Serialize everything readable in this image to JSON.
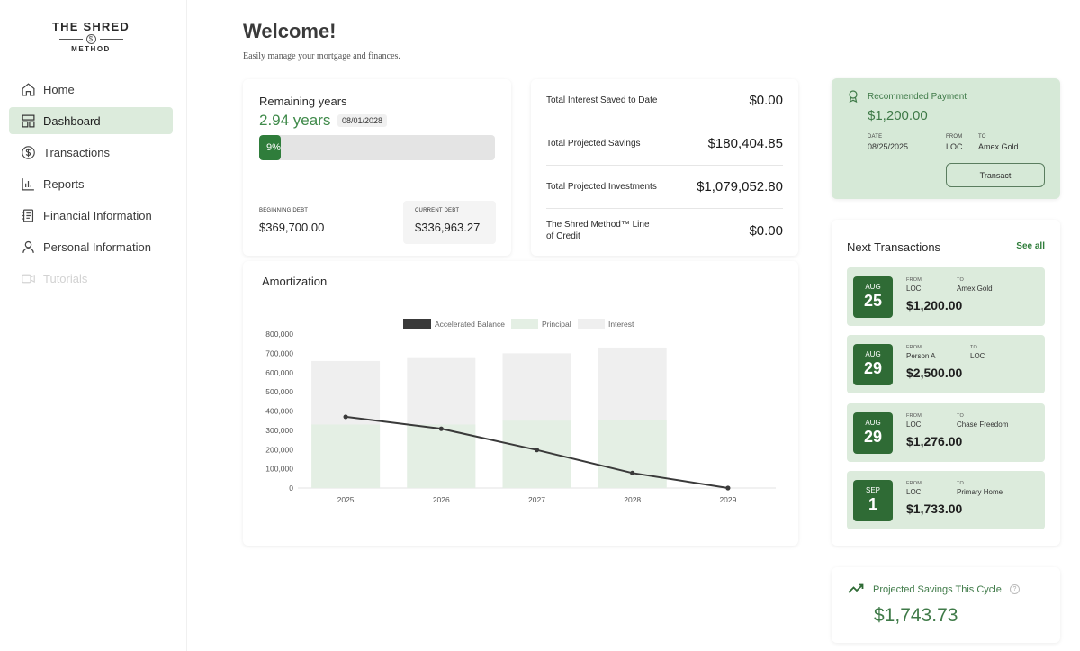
{
  "logo": {
    "line1": "THE SHRED",
    "coin": "$",
    "line2": "METHOD"
  },
  "nav": [
    {
      "label": "Home",
      "icon": "home-icon"
    },
    {
      "label": "Dashboard",
      "icon": "dashboard-icon",
      "active": true
    },
    {
      "label": "Transactions",
      "icon": "dollar-circle-icon"
    },
    {
      "label": "Reports",
      "icon": "bar-chart-icon"
    },
    {
      "label": "Financial Information",
      "icon": "document-icon"
    },
    {
      "label": "Personal Information",
      "icon": "user-icon"
    },
    {
      "label": "Tutorials",
      "icon": "video-icon",
      "disabled": true
    }
  ],
  "header": {
    "title": "Welcome!",
    "subtitle": "Easily manage your mortgage and finances."
  },
  "remaining": {
    "label": "Remaining years",
    "value": "2.94 years",
    "date": "08/01/2028",
    "progress_text": "9%",
    "progress_fraction": 0.09,
    "beginning_label": "BEGINNING DEBT",
    "beginning_value": "$369,700.00",
    "current_label": "CURRENT DEBT",
    "current_value": "$336,963.27"
  },
  "totals": [
    {
      "label": "Total Interest Saved to Date",
      "value": "$0.00"
    },
    {
      "label": "Total Projected Savings",
      "value": "$180,404.85"
    },
    {
      "label": "Total Projected Investments",
      "value": "$1,079,052.80"
    },
    {
      "label": "The Shred Method™ Line of Credit",
      "value": "$0.00"
    }
  ],
  "amortization": {
    "title": "Amortization"
  },
  "chart_data": {
    "type": "bar",
    "categories": [
      "2025",
      "2026",
      "2027",
      "2028",
      "2029"
    ],
    "series": [
      {
        "name": "Principal",
        "type": "bar",
        "values": [
          330000,
          330000,
          350000,
          355000,
          null
        ]
      },
      {
        "name": "Interest",
        "type": "bar",
        "values": [
          660000,
          675000,
          700000,
          730000,
          null
        ]
      },
      {
        "name": "Accelerated Balance",
        "type": "line",
        "values": [
          370000,
          308000,
          198000,
          78000,
          0
        ]
      }
    ],
    "y_ticks": [
      "800,000",
      "700,000",
      "600,000",
      "500,000",
      "400,000",
      "300,000",
      "200,000",
      "100,000",
      "0"
    ],
    "ylim": [
      0,
      800000
    ],
    "legend_position": "top",
    "colors": {
      "balance": "#3a3a3a",
      "principal": "#e4efe4",
      "interest": "#efefef"
    }
  },
  "recommended": {
    "label": "Recommended Payment",
    "amount": "$1,200.00",
    "date_label": "DATE",
    "date_value": "08/25/2025",
    "from_label": "FROM",
    "from_value": "LOC",
    "to_label": "TO",
    "to_value": "Amex Gold",
    "button": "Transact"
  },
  "next": {
    "title": "Next Transactions",
    "see_all": "See all",
    "from_label": "FROM",
    "to_label": "TO",
    "items": [
      {
        "month": "AUG",
        "day": "25",
        "from": "LOC",
        "to": "Amex Gold",
        "amount": "$1,200.00"
      },
      {
        "month": "AUG",
        "day": "29",
        "from": "Person A",
        "to": "LOC",
        "amount": "$2,500.00"
      },
      {
        "month": "AUG",
        "day": "29",
        "from": "LOC",
        "to": "Chase Freedom",
        "amount": "$1,276.00"
      },
      {
        "month": "SEP",
        "day": "1",
        "from": "LOC",
        "to": "Primary Home",
        "amount": "$1,733.00"
      }
    ]
  },
  "projected": {
    "label": "Projected Savings This Cycle",
    "value": "$1,743.73",
    "help": "?"
  },
  "colors": {
    "accent": "#2f7d3b",
    "accent_light": "#dcebdc",
    "accent_text": "#3f7a48"
  }
}
